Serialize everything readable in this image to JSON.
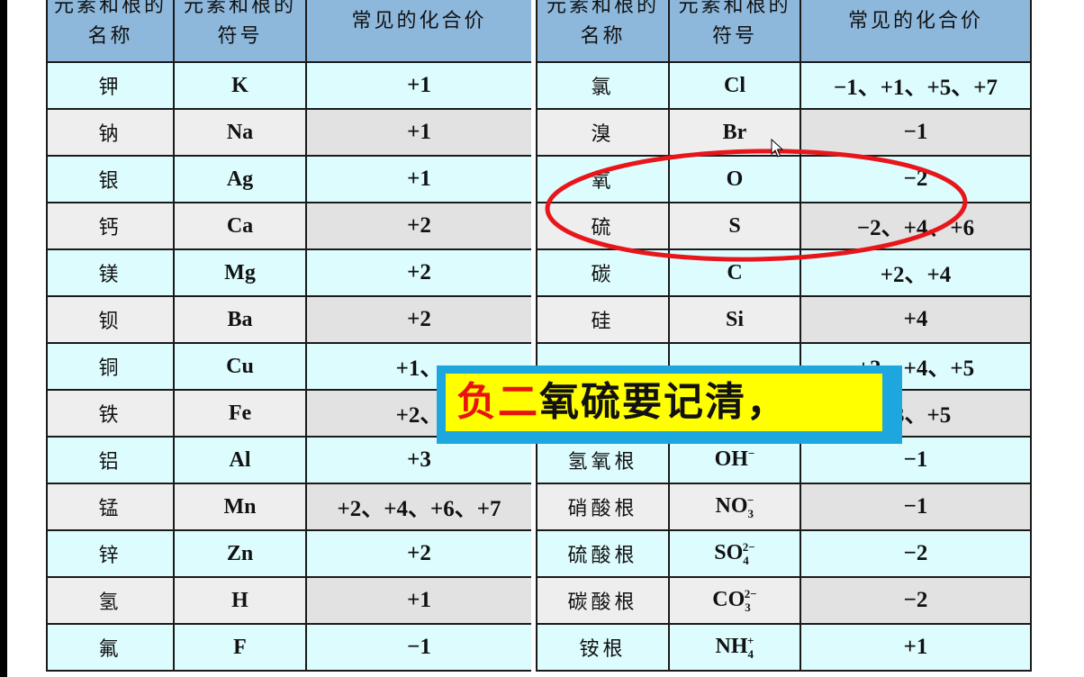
{
  "tables": {
    "headers": [
      "元素和根的名称",
      "元素和根的符号",
      "常见的化合价"
    ],
    "left": [
      {
        "name": "钾",
        "symbol": "K",
        "valence": "+1"
      },
      {
        "name": "钠",
        "symbol": "Na",
        "valence": "+1"
      },
      {
        "name": "银",
        "symbol": "Ag",
        "valence": "+1"
      },
      {
        "name": "钙",
        "symbol": "Ca",
        "valence": "+2"
      },
      {
        "name": "镁",
        "symbol": "Mg",
        "valence": "+2"
      },
      {
        "name": "钡",
        "symbol": "Ba",
        "valence": "+2"
      },
      {
        "name": "铜",
        "symbol": "Cu",
        "valence": "+1、"
      },
      {
        "name": "铁",
        "symbol": "Fe",
        "valence": "+2、"
      },
      {
        "name": "铝",
        "symbol": "Al",
        "valence": "+3"
      },
      {
        "name": "锰",
        "symbol": "Mn",
        "valence": "+2、+4、+6、+7"
      },
      {
        "name": "锌",
        "symbol": "Zn",
        "valence": "+2"
      },
      {
        "name": "氢",
        "symbol": "H",
        "valence": "+1"
      },
      {
        "name": "氟",
        "symbol": "F",
        "valence": "−1"
      }
    ],
    "right": [
      {
        "name": "氯",
        "symbol": "Cl",
        "sub": "",
        "sup": "",
        "valence": "−1、+1、+5、+7"
      },
      {
        "name": "溴",
        "symbol": "Br",
        "sub": "",
        "sup": "",
        "valence": "−1"
      },
      {
        "name": "氧",
        "symbol": "O",
        "sub": "",
        "sup": "",
        "valence": "−2"
      },
      {
        "name": "硫",
        "symbol": "S",
        "sub": "",
        "sup": "",
        "valence": "−2、+4、+6"
      },
      {
        "name": "碳",
        "symbol": "C",
        "sub": "",
        "sup": "",
        "valence": "+2、+4"
      },
      {
        "name": "硅",
        "symbol": "Si",
        "sub": "",
        "sup": "",
        "valence": "+4"
      },
      {
        "name": "",
        "symbol": "",
        "sub": "",
        "sup": "",
        "valence": "+3、+4、+5"
      },
      {
        "name": "",
        "symbol": "",
        "sub": "",
        "sup": "",
        "valence": "+3、+5"
      },
      {
        "name": "氢氧根",
        "symbol": "OH",
        "sub": "",
        "sup": "−",
        "valence": "−1"
      },
      {
        "name": "硝酸根",
        "symbol": "NO",
        "sub": "3",
        "sup": "−",
        "valence": "−1"
      },
      {
        "name": "硫酸根",
        "symbol": "SO",
        "sub": "4",
        "sup": "2−",
        "valence": "−2"
      },
      {
        "name": "碳酸根",
        "symbol": "CO",
        "sub": "3",
        "sup": "2−",
        "valence": "−2"
      },
      {
        "name": "铵根",
        "symbol": "NH",
        "sub": "4",
        "sup": "+",
        "valence": "+1"
      }
    ]
  },
  "banner": {
    "red_text": "负二",
    "black_text": "氧硫要记清，",
    "border_color": "#1ea6de",
    "fill_color": "#ffff00",
    "red_color": "#e8130f"
  },
  "annotation": {
    "ellipse_color": "#e8161b",
    "circled_rows": [
      "氧",
      "硫"
    ]
  }
}
